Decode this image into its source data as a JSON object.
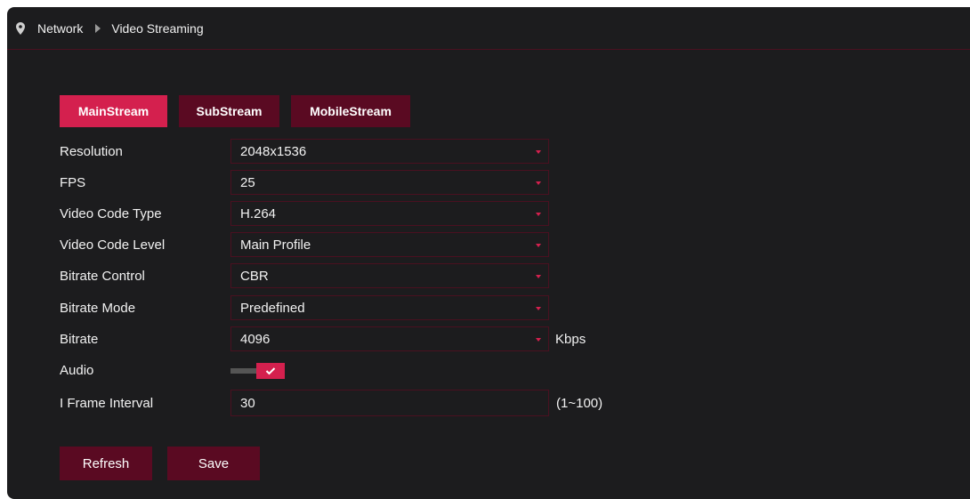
{
  "breadcrumb": {
    "items": [
      "Network",
      "Video Streaming"
    ]
  },
  "tabs": [
    {
      "label": "MainStream",
      "active": true
    },
    {
      "label": "SubStream",
      "active": false
    },
    {
      "label": "MobileStream",
      "active": false
    }
  ],
  "fields": {
    "resolution": {
      "label": "Resolution",
      "value": "2048x1536"
    },
    "fps": {
      "label": "FPS",
      "value": "25"
    },
    "video_code_type": {
      "label": "Video Code Type",
      "value": "H.264"
    },
    "video_code_level": {
      "label": "Video Code Level",
      "value": "Main Profile"
    },
    "bitrate_control": {
      "label": "Bitrate Control",
      "value": "CBR"
    },
    "bitrate_mode": {
      "label": "Bitrate Mode",
      "value": "Predefined"
    },
    "bitrate": {
      "label": "Bitrate",
      "value": "4096",
      "unit": "Kbps"
    },
    "audio": {
      "label": "Audio",
      "enabled": true
    },
    "i_frame_interval": {
      "label": "I Frame Interval",
      "value": "30",
      "range": "(1~100)"
    }
  },
  "actions": {
    "refresh_label": "Refresh",
    "save_label": "Save"
  },
  "colors": {
    "accent": "#d4204e",
    "inactive_tab": "#5a0a22",
    "panel_bg": "#1c1c1e",
    "border": "#4a1020"
  },
  "icons": {
    "location": "location-pin-icon",
    "separator": "triangle-right-icon",
    "dropdown": "caret-down-icon",
    "toggle_check": "check-icon"
  }
}
